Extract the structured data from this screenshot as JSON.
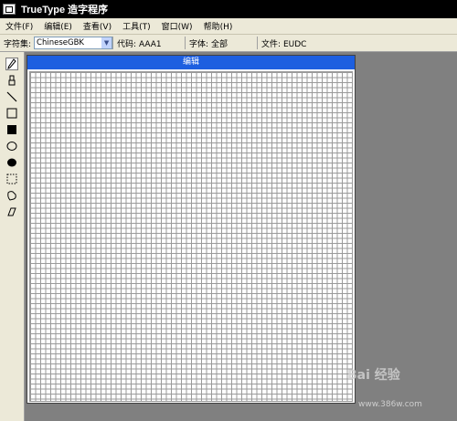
{
  "window": {
    "title": "TrueType 造字程序"
  },
  "menu": [
    "文件(F)",
    "编辑(E)",
    "查看(V)",
    "工具(T)",
    "窗口(W)",
    "帮助(H)"
  ],
  "status": {
    "charset_label": "字符集:",
    "charset_value": "ChineseGBK",
    "code": "代码: AAA1",
    "font": "字体: 全部",
    "file": "文件: EUDC"
  },
  "editor": {
    "title": "编辑"
  },
  "tools": [
    "pencil-icon",
    "brush-icon",
    "line-icon",
    "hollow-rectangle-icon",
    "filled-rectangle-icon",
    "hollow-ellipse-icon",
    "filled-ellipse-icon",
    "rectangle-select-icon",
    "freeform-select-icon",
    "eraser-icon"
  ],
  "watermark": {
    "text": "Bai 经验",
    "site": "www.386w.com"
  }
}
